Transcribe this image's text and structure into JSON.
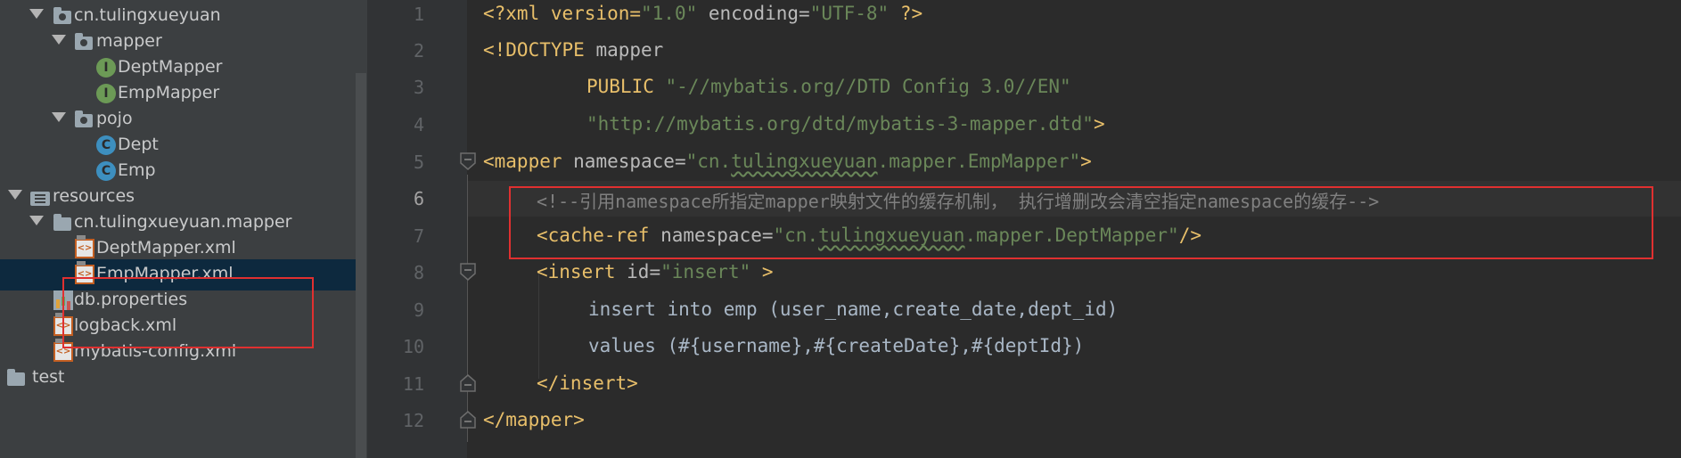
{
  "tree": {
    "items": [
      {
        "label": "cn.tulingxueyuan",
        "icon": "package-folder-icon",
        "expanded": true
      },
      {
        "label": "mapper",
        "icon": "package-folder-icon",
        "expanded": true
      },
      {
        "label": "DeptMapper",
        "icon": "interface-icon",
        "badge": "I"
      },
      {
        "label": "EmpMapper",
        "icon": "interface-icon",
        "badge": "I"
      },
      {
        "label": "pojo",
        "icon": "package-folder-icon",
        "expanded": true
      },
      {
        "label": "Dept",
        "icon": "class-icon",
        "badge": "C"
      },
      {
        "label": "Emp",
        "icon": "class-icon",
        "badge": "C"
      },
      {
        "label": "resources",
        "icon": "resources-folder-icon",
        "expanded": true
      },
      {
        "label": "cn.tulingxueyuan.mapper",
        "icon": "folder-icon",
        "expanded": true
      },
      {
        "label": "DeptMapper.xml",
        "icon": "xml-file-icon",
        "badge": "<>"
      },
      {
        "label": "EmpMapper.xml",
        "icon": "xml-file-icon",
        "badge": "<>",
        "selected": true
      },
      {
        "label": "db.properties",
        "icon": "properties-file-icon"
      },
      {
        "label": "logback.xml",
        "icon": "xml-file-icon",
        "badge": "<>"
      },
      {
        "label": "mybatis-config.xml",
        "icon": "xml-file-icon",
        "badge": "<>"
      },
      {
        "label": "test",
        "icon": "folder-icon"
      }
    ]
  },
  "editor": {
    "line_numbers": [
      "1",
      "2",
      "3",
      "4",
      "5",
      "6",
      "7",
      "8",
      "9",
      "10",
      "11",
      "12"
    ],
    "lines": {
      "l1": {
        "a": "<?xml version=",
        "b": "\"1.0\"",
        "c": " encoding=",
        "d": "\"UTF-8\"",
        "e": " ?>"
      },
      "l2": {
        "a": "<!DOCTYPE ",
        "b": "mapper"
      },
      "l3": {
        "a": "PUBLIC ",
        "b": "\"-//mybatis.org//DTD Config 3.0//EN\""
      },
      "l4": {
        "a": "\"http://mybatis.org/dtd/mybatis-3-mapper.dtd\"",
        "b": ">"
      },
      "l5": {
        "a": "<mapper ",
        "b": "namespace=",
        "c": "\"cn.",
        "d": "tulingxueyuan",
        "e": ".mapper.EmpMapper\"",
        "f": ">"
      },
      "l6": {
        "a": "<!--引用namespace所指定mapper映射文件的缓存机制， 执行增删改会清空指定namespace的缓存-->"
      },
      "l7": {
        "a": "<cache-ref ",
        "b": "namespace=",
        "c": "\"cn.",
        "d": "tulingxueyuan",
        "e": ".mapper.DeptMapper\"",
        "f": "/>"
      },
      "l8": {
        "a": "<insert ",
        "b": "id=",
        "c": "\"insert\"",
        "d": " >"
      },
      "l9": {
        "a": "insert into emp (user_name,create_date,dept_id)"
      },
      "l10": {
        "a": "values (#{username},#{createDate},#{deptId})"
      },
      "l11": {
        "a": "</insert>"
      },
      "l12": {
        "a": "</mapper>"
      }
    }
  },
  "colors": {
    "tree_bg": "#3c3f41",
    "editor_bg": "#2b2b2b",
    "highlight_box": "#e03030",
    "tag": "#e8bf6a",
    "string": "#6a8759",
    "comment": "#808080"
  }
}
